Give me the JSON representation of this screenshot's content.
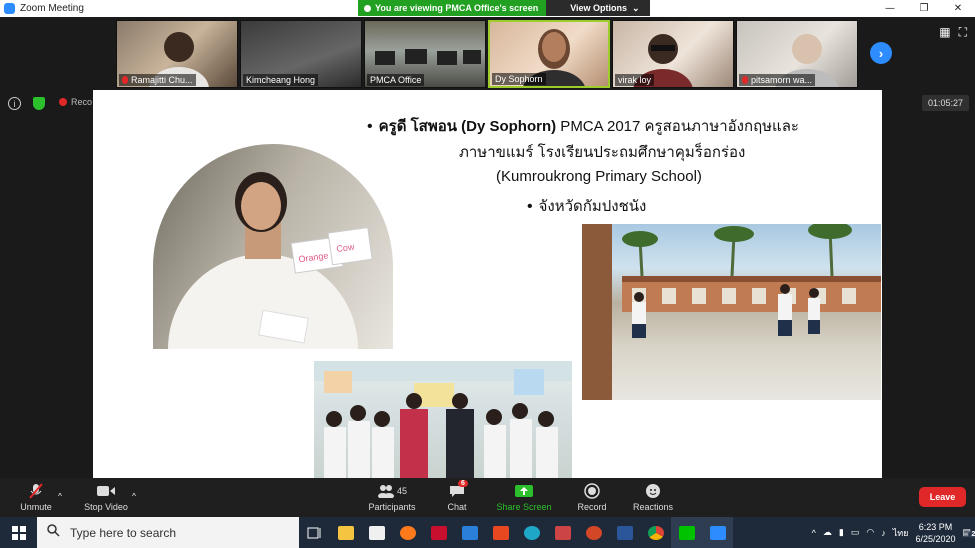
{
  "window": {
    "title": "Zoom Meeting"
  },
  "share_banner": {
    "viewing_text": "You are viewing PMCA Office's screen",
    "view_options_label": "View Options"
  },
  "participants_strip": [
    {
      "name": "Ramajitti Chu...",
      "muted": true
    },
    {
      "name": "Kimcheang Hong",
      "muted": false
    },
    {
      "name": "PMCA Office",
      "muted": false
    },
    {
      "name": "Dy Sophorn",
      "muted": false,
      "active": true
    },
    {
      "name": "virak loy",
      "muted": false
    },
    {
      "name": "pitsamorn wa...",
      "muted": true
    }
  ],
  "status": {
    "recording_label": "Reco",
    "elapsed": "01:05:27"
  },
  "slide": {
    "line1_bold": "ครูดี โสพอน (Dy Sophorn)",
    "line1_rest": " PMCA 2017  ครูสอนภาษาอังกฤษและ",
    "line2": "ภาษาขแมร์ โรงเรียนประถมศึกษาคุมร็อกร่อง",
    "line3": "(Kumroukrong Primary School)",
    "line4": "จังหวัดกัมปงชนัง",
    "card_words": [
      "Orange",
      "Cow"
    ]
  },
  "toolbar": {
    "unmute": "Unmute",
    "stop_video": "Stop Video",
    "participants": "Participants",
    "participants_count": "45",
    "chat": "Chat",
    "chat_badge": "6",
    "share_screen": "Share Screen",
    "record": "Record",
    "reactions": "Reactions",
    "leave": "Leave"
  },
  "taskbar": {
    "search_placeholder": "Type here to search",
    "language": "ไทย",
    "time": "6:23 PM",
    "date": "6/25/2020",
    "notifications": "22"
  },
  "colors": {
    "zoom_blue": "#2d8cff",
    "share_green": "#21a021",
    "leave_red": "#e02828",
    "active_border": "#9ccd2d"
  }
}
